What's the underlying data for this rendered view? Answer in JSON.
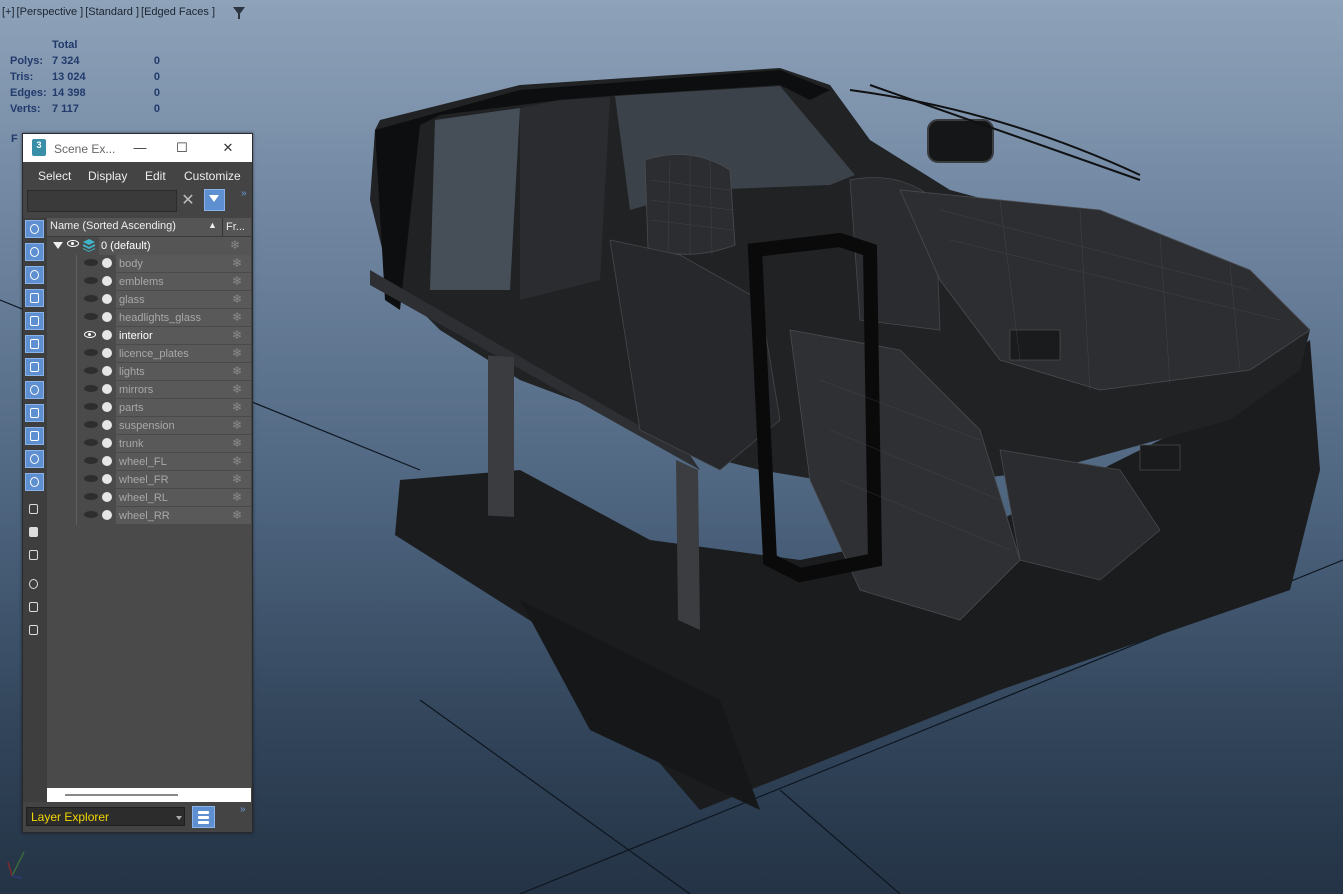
{
  "viewport": {
    "labels": [
      "[+]",
      "[Perspective ]",
      "[Standard ]",
      "[Edged Faces ]"
    ],
    "filter_icon": "filter-icon"
  },
  "stats": {
    "header": "Total",
    "rows": [
      {
        "label": "Polys:",
        "total": "7 324",
        "selected": "0"
      },
      {
        "label": "Tris:",
        "total": "13 024",
        "selected": "0"
      },
      {
        "label": "Edges:",
        "total": "14 398",
        "selected": "0"
      },
      {
        "label": "Verts:",
        "total": "7 117",
        "selected": "0"
      }
    ],
    "fps_fragment": "F"
  },
  "scene_explorer": {
    "title": "Scene Ex...",
    "app_icon": "3ds-max-icon",
    "window_buttons": {
      "minimize": "—",
      "maximize": "☐",
      "close": "✕"
    },
    "menu": [
      "Select",
      "Display",
      "Edit",
      "Customize"
    ],
    "search": {
      "value": "",
      "placeholder": ""
    },
    "clear_glyph": "✕",
    "more_glyph": "»",
    "columns": {
      "name": "Name (Sorted Ascending)",
      "sort_glyph": "▲",
      "freeze": "Fr..."
    },
    "root_layer": {
      "label": "0 (default)",
      "freeze_glyph": "❄"
    },
    "layers": [
      {
        "name": "body",
        "visible": false,
        "active": false
      },
      {
        "name": "emblems",
        "visible": false,
        "active": false
      },
      {
        "name": "glass",
        "visible": false,
        "active": false
      },
      {
        "name": "headlights_glass",
        "visible": false,
        "active": false
      },
      {
        "name": "interior",
        "visible": true,
        "active": true
      },
      {
        "name": "licence_plates",
        "visible": false,
        "active": false
      },
      {
        "name": "lights",
        "visible": false,
        "active": false
      },
      {
        "name": "mirrors",
        "visible": false,
        "active": false
      },
      {
        "name": "parts",
        "visible": false,
        "active": false
      },
      {
        "name": "suspension",
        "visible": false,
        "active": false
      },
      {
        "name": "trunk",
        "visible": false,
        "active": false
      },
      {
        "name": "wheel_FL",
        "visible": false,
        "active": false
      },
      {
        "name": "wheel_FR",
        "visible": false,
        "active": false
      },
      {
        "name": "wheel_RL",
        "visible": false,
        "active": false
      },
      {
        "name": "wheel_RR",
        "visible": false,
        "active": false
      }
    ],
    "freeze_glyph": "❄",
    "explorer_type": "Layer Explorer",
    "toolbar_icons": [
      "display-none-icon",
      "geometry-icon",
      "lights-icon",
      "cameras-icon",
      "helpers-icon",
      "space-warps-icon",
      "groups-icon",
      "xrefs-icon",
      "bones-icon",
      "containers-icon",
      "frozen-icon",
      "hidden-icon",
      "display-all-icon",
      "display-none-list-icon",
      "invert-icon",
      "filter-settings-icon",
      "filter-icon",
      "sync-selection-icon"
    ]
  },
  "colors": {
    "accent_button": "#5e8fd0",
    "stats_text": "#223a6b",
    "explorer_label": "#f2d600"
  }
}
